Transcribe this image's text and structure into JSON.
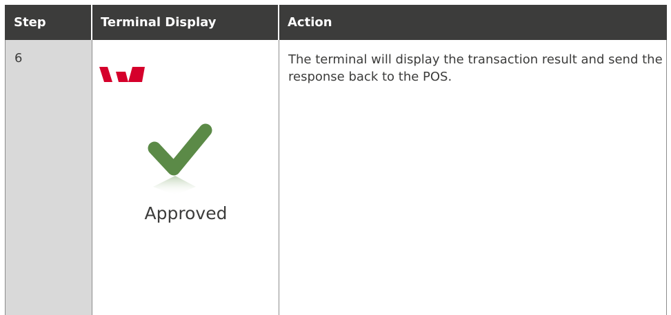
{
  "header": {
    "step": "Step",
    "terminal_display": "Terminal Display",
    "action": "Action"
  },
  "rows": [
    {
      "step": "6",
      "display": {
        "logo_icon": "westpac-logo",
        "status_icon": "green-checkmark-icon",
        "status_text": "Approved"
      },
      "action": "The terminal will display the transaction result and send the response back to the POS."
    }
  ],
  "colors": {
    "header_bg": "#3c3c3b",
    "step_col_bg": "#d9d9d9",
    "logo_red": "#d5002b",
    "check_green": "#5b8a47"
  }
}
